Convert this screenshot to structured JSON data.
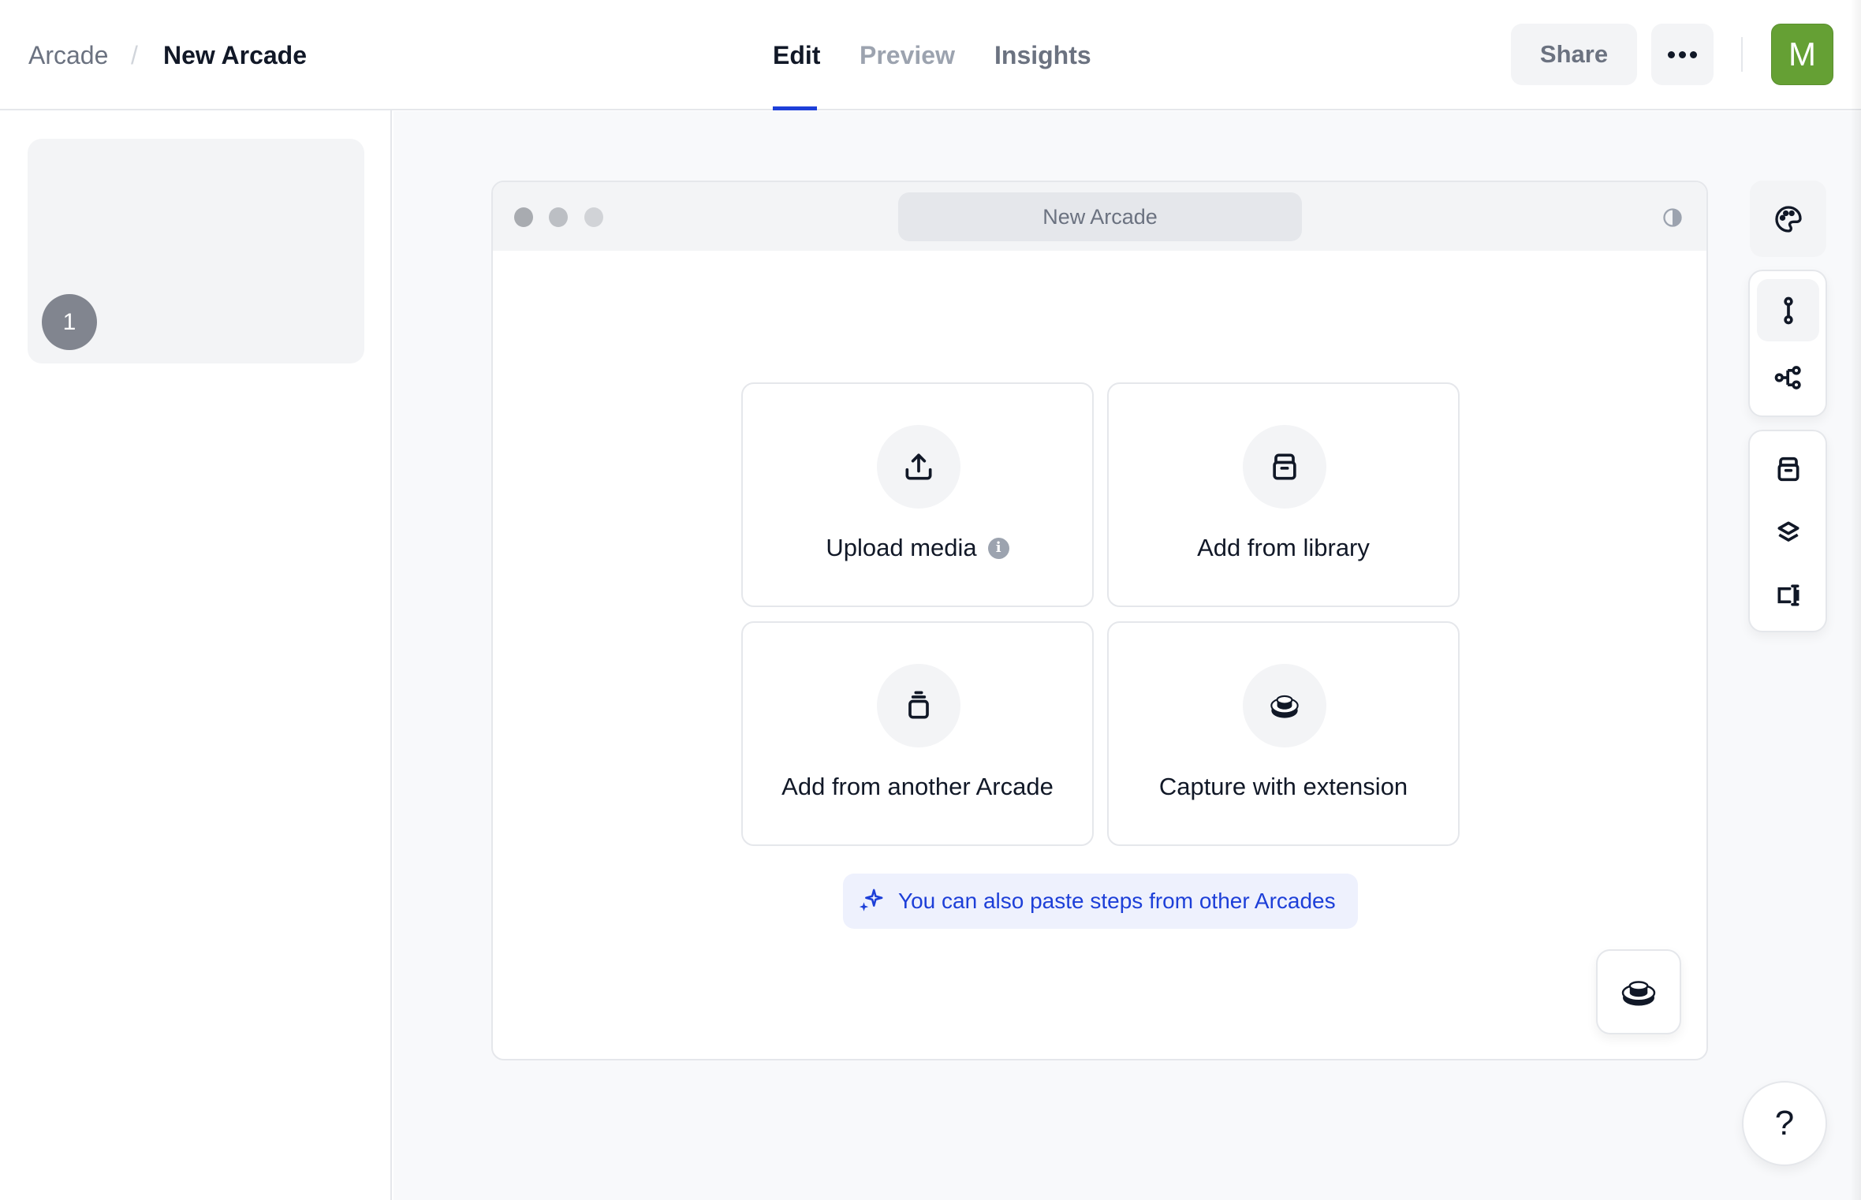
{
  "header": {
    "breadcrumb": {
      "root": "Arcade",
      "separator": "/",
      "current": "New Arcade"
    },
    "tabs": [
      {
        "label": "Edit",
        "active": true
      },
      {
        "label": "Preview",
        "active": false
      },
      {
        "label": "Insights",
        "active": false
      }
    ],
    "share_label": "Share",
    "more_icon": "more-horizontal-icon",
    "avatar_initial": "M",
    "avatar_color": "#65a034",
    "accent_color": "#1d3fd8"
  },
  "sidebar": {
    "steps": [
      {
        "number": "1"
      }
    ]
  },
  "frame": {
    "url_title": "New Arcade",
    "theme_icon": "contrast-icon"
  },
  "actions": [
    {
      "label": "Upload media",
      "icon": "upload-icon",
      "info": "i"
    },
    {
      "label": "Add from library",
      "icon": "library-icon"
    },
    {
      "label": "Add from another Arcade",
      "icon": "arcade-stack-icon"
    },
    {
      "label": "Capture with extension",
      "icon": "record-button-icon"
    }
  ],
  "tip": {
    "icon": "sparkles-icon",
    "text": "You can also paste steps from other Arcades"
  },
  "toolbar": {
    "items": [
      {
        "icon": "palette-icon"
      },
      {
        "icon": "linear-flow-icon",
        "active": true
      },
      {
        "icon": "branching-flow-icon"
      },
      {
        "icon": "library-icon"
      },
      {
        "icon": "layers-icon"
      },
      {
        "icon": "text-field-icon"
      }
    ]
  },
  "help_label": "?"
}
